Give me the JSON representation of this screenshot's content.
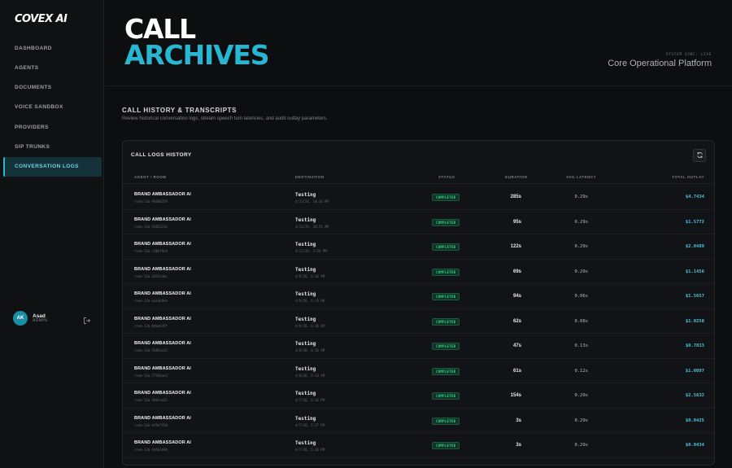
{
  "app": {
    "logo": "COVEX AI"
  },
  "sidebar": {
    "items": [
      {
        "label": "DASHBOARD"
      },
      {
        "label": "AGENTS"
      },
      {
        "label": "DOCUMENTS"
      },
      {
        "label": "VOICE SANDBOX"
      },
      {
        "label": "PROVIDERS"
      },
      {
        "label": "SIP TRUNKS"
      },
      {
        "label": "CONVERSATION LOGS",
        "active": true
      }
    ],
    "user": {
      "initials": "AK",
      "name": "Asad",
      "role": "ADMIN"
    }
  },
  "header": {
    "title_line1": "CALL",
    "title_line2": "ARCHIVES",
    "system_sync": "SYSTEM SYNC: LIVE",
    "platform": "Core Operational Platform"
  },
  "section": {
    "title": "CALL HISTORY & TRANSCRIPTS",
    "subtitle": "Review historical conversation logs, stream speech turn latencies, and audit outlay parameters."
  },
  "card": {
    "title": "CALL LOGS HISTORY"
  },
  "table": {
    "columns": {
      "agent": "AGENT / ROOM",
      "destination": "DESTINATION",
      "status": "STATUS",
      "duration": "DURATION",
      "latency": "AVG LATENCY",
      "outlay": "TOTAL OUTLAY"
    },
    "rows": [
      {
        "agent": "BRAND AMBASSADOR AI",
        "room": "room-13a-9b0d8259",
        "destination": "Testing",
        "date": "4/13/26, 10:14 AM",
        "status": "COMPLETED",
        "duration": "285s",
        "latency": "0.29s",
        "outlay": "$4.7434"
      },
      {
        "agent": "BRAND AMBASSADOR AI",
        "room": "room-13a-1b82123a",
        "destination": "Testing",
        "date": "4/13/26, 10:51 AM",
        "status": "COMPLETED",
        "duration": "95s",
        "latency": "0.29s",
        "outlay": "$1.5772"
      },
      {
        "agent": "BRAND AMBASSADOR AI",
        "room": "room-13a-c30bf9e4",
        "destination": "Testing",
        "date": "4/12/26, 2:54 PM",
        "status": "COMPLETED",
        "duration": "122s",
        "latency": "0.29s",
        "outlay": "$2.0489"
      },
      {
        "agent": "BRAND AMBASSADOR AI",
        "room": "room-13a-2037cabc",
        "destination": "Testing",
        "date": "4/9/26, 6:36 AM",
        "status": "COMPLETED",
        "duration": "69s",
        "latency": "0.29s",
        "outlay": "$1.1456"
      },
      {
        "agent": "BRAND AMBASSADOR AI",
        "room": "room-13a-aacab9ae",
        "destination": "Testing",
        "date": "4/9/26, 6:19 AM",
        "status": "COMPLETED",
        "duration": "94s",
        "latency": "0.06s",
        "outlay": "$1.5657"
      },
      {
        "agent": "BRAND AMBASSADOR AI",
        "room": "room-13a-8daeb19f",
        "destination": "Testing",
        "date": "4/8/26, 6:16 AM",
        "status": "COMPLETED",
        "duration": "62s",
        "latency": "0.08s",
        "outlay": "$1.0250"
      },
      {
        "agent": "BRAND AMBASSADOR AI",
        "room": "room-13a-7b85ee12",
        "destination": "Testing",
        "date": "4/8/26, 6:16 AM",
        "status": "COMPLETED",
        "duration": "47s",
        "latency": "0.13s",
        "outlay": "$0.7833"
      },
      {
        "agent": "BRAND AMBASSADOR AI",
        "room": "room-13a-777b6ae3",
        "destination": "Testing",
        "date": "4/8/26, 6:14 AM",
        "status": "COMPLETED",
        "duration": "61s",
        "latency": "0.12s",
        "outlay": "$1.0097"
      },
      {
        "agent": "BRAND AMBASSADOR AI",
        "room": "room-13a-3b6cae21",
        "destination": "Testing",
        "date": "4/7/26, 6:16 PM",
        "status": "COMPLETED",
        "duration": "154s",
        "latency": "0.29s",
        "outlay": "$2.5632"
      },
      {
        "agent": "BRAND AMBASSADOR AI",
        "room": "room-13a-bf9e7fb8",
        "destination": "Testing",
        "date": "4/7/26, 5:37 PM",
        "status": "COMPLETED",
        "duration": "3s",
        "latency": "0.29s",
        "outlay": "$0.0425"
      },
      {
        "agent": "BRAND AMBASSADOR AI",
        "room": "room-13a-4a5b1b9d",
        "destination": "Testing",
        "date": "4/7/26, 5:36 PM",
        "status": "COMPLETED",
        "duration": "3s",
        "latency": "0.29s",
        "outlay": "$0.0434"
      }
    ]
  },
  "colors": {
    "accent": "#27b7d3",
    "status_green": "#35d48a",
    "background": "#0d0e10"
  },
  "icons": {
    "refresh": "refresh-icon",
    "logout": "logout-icon"
  }
}
